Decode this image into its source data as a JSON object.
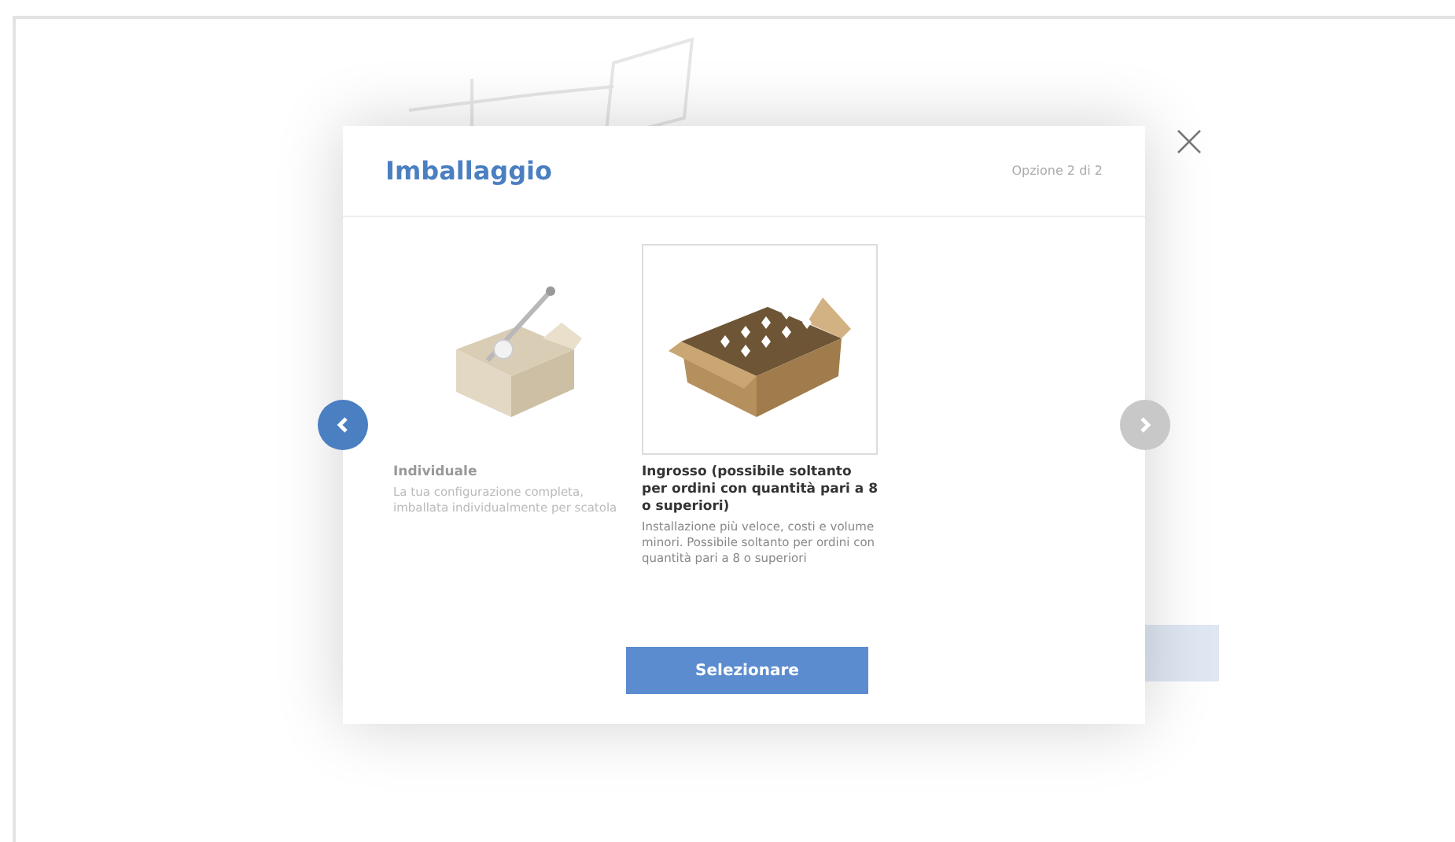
{
  "dialog": {
    "title": "Imballaggio",
    "counter": "Opzione 2 di 2",
    "options": [
      {
        "kind": "single",
        "title": "Individuale",
        "description": "La tua configurazione completa, imballata individualmente per scatola",
        "selected": false
      },
      {
        "kind": "bulk",
        "title": "Ingrosso (possibile soltanto per ordini con quantità pari a 8 o superiori)",
        "description": "Installazione più veloce, costi e volume minori. Possibile soltanto per ordini con quantità pari a 8 o superiori",
        "selected": true
      }
    ],
    "nav": [
      {
        "kind": "previous",
        "disabled": false
      },
      {
        "kind": "next",
        "disabled": true
      }
    ],
    "button": "Selezionare"
  }
}
